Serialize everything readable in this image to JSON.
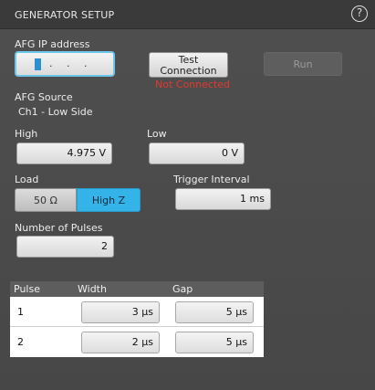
{
  "header": {
    "title": "GENERATOR SETUP",
    "help_glyph": "?"
  },
  "afg_ip": {
    "label": "AFG IP address",
    "value_dots": ". . .",
    "test_button": "Test Connection",
    "status": "Not Connected",
    "run_button": "Run"
  },
  "afg_source": {
    "label": "AFG Source",
    "value": "Ch1 - Low Side"
  },
  "high": {
    "label": "High",
    "value": "4.975 V"
  },
  "low": {
    "label": "Low",
    "value": "0 V"
  },
  "load": {
    "label": "Load",
    "options": [
      "50 Ω",
      "High Z"
    ],
    "selected": "High Z"
  },
  "trigger_interval": {
    "label": "Trigger Interval",
    "value": "1 ms"
  },
  "pulses": {
    "label": "Number of Pulses",
    "value": "2"
  },
  "table": {
    "headers": [
      "Pulse",
      "Width",
      "Gap"
    ],
    "rows": [
      {
        "pulse": "1",
        "width": "3 μs",
        "gap": "5 μs"
      },
      {
        "pulse": "2",
        "width": "2 μs",
        "gap": "5 μs"
      }
    ]
  },
  "colors": {
    "accent": "#33b3e8",
    "status_error": "#e03a2e"
  }
}
